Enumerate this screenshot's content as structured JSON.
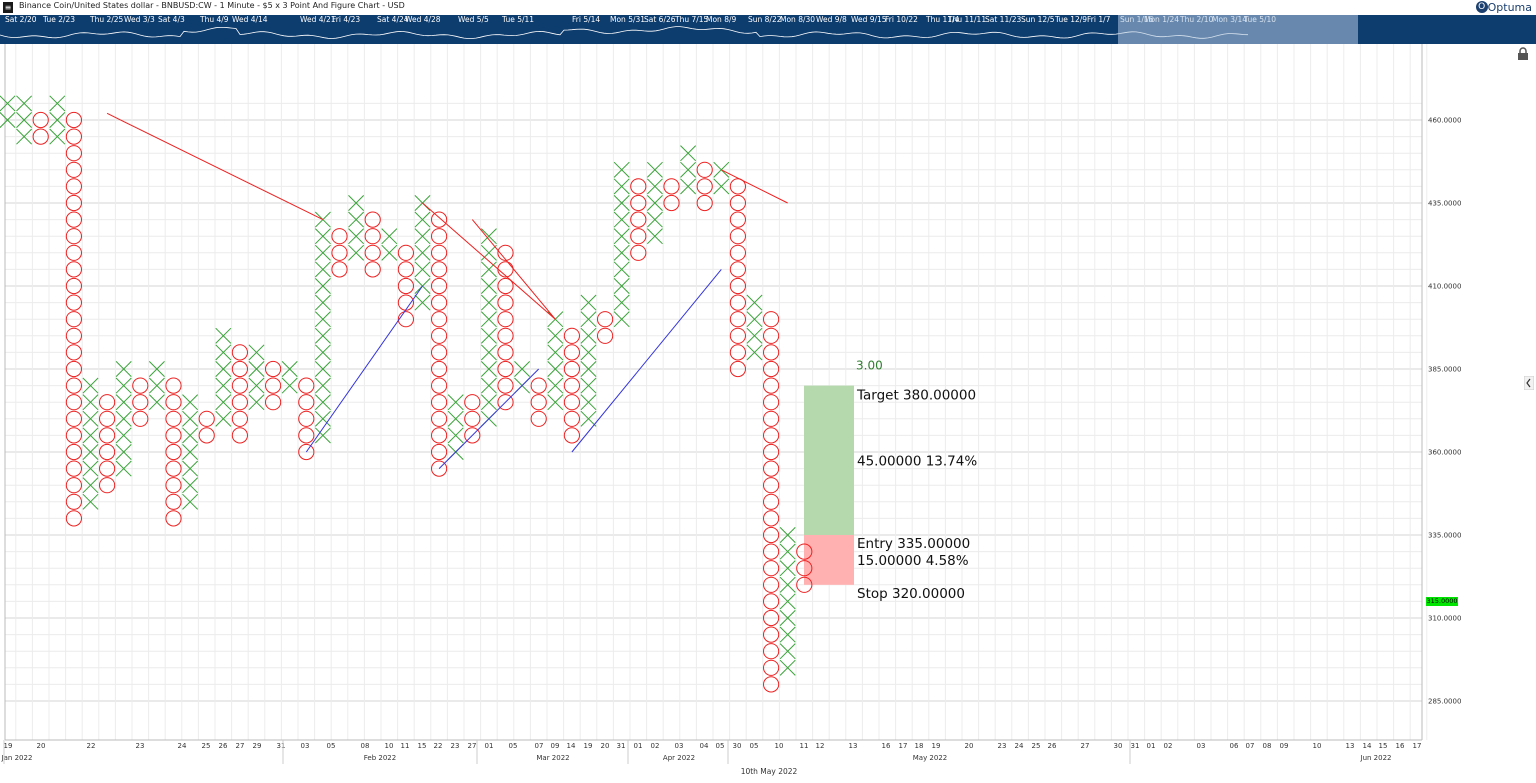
{
  "window": {
    "title": "Binance Coin/United States dollar - BNBUSD:CW - 1 Minute - $5 x 3 Point And Figure Chart - USD",
    "logo": "Optuma"
  },
  "navigator": {
    "labels": [
      "Sat 2/20",
      "Tue 2/23",
      "Thu 2/25",
      "Wed 3/3",
      "Sat 4/3",
      "Thu 4/9",
      "Wed 4/14",
      "Wed 4/21",
      "Fri 4/23",
      "Sat 4/24",
      "Wed 4/28",
      "Wed 5/5",
      "Tue 5/11",
      "Fri 5/14",
      "Mon 5/31",
      "Sat 6/26",
      "Thu 7/15",
      "Mon 8/9",
      "Sun 8/22",
      "Mon 8/30",
      "Wed 9/8",
      "Wed 9/15",
      "Fri 10/22",
      "Thu 11/4",
      "Thu 11/11",
      "Sat 11/23",
      "Sun 12/5",
      "Tue 12/9",
      "Fri 1/7",
      "Sun 1/16",
      "Mon 1/24",
      "Thu 2/10",
      "Mon 3/14",
      "Tue 5/10"
    ]
  },
  "icons": {
    "lock": "lock-icon",
    "collapse": "chevron-left-icon",
    "menu": "menu-icon"
  },
  "colors": {
    "x": "#39a339",
    "o": "#ee2020",
    "up_trend": "#3333dd",
    "down_trend": "#ee2020",
    "target_box": "#b5d9ad",
    "stop_box": "#ffb0b0",
    "navigator": "#0d3c6e",
    "last_price": "#00e600"
  },
  "chart_data": {
    "type": "point-and-figure",
    "box_size": 5,
    "reversal": 3,
    "ylim": [
      280,
      465
    ],
    "y_ticks": [
      "460.0000",
      "435.0000",
      "410.0000",
      "385.0000",
      "360.0000",
      "335.0000",
      "310.0000",
      "285.0000"
    ],
    "last_price": "315.0000",
    "columns": [
      {
        "t": "X",
        "low": 460,
        "high": 465
      },
      {
        "t": "X",
        "low": 455,
        "high": 465
      },
      {
        "t": "O",
        "low": 455,
        "high": 460
      },
      {
        "t": "X",
        "low": 455,
        "high": 465
      },
      {
        "t": "O",
        "low": 340,
        "high": 460
      },
      {
        "t": "X",
        "low": 345,
        "high": 380
      },
      {
        "t": "O",
        "low": 350,
        "high": 375
      },
      {
        "t": "X",
        "low": 355,
        "high": 385
      },
      {
        "t": "O",
        "low": 370,
        "high": 380
      },
      {
        "t": "X",
        "low": 375,
        "high": 385
      },
      {
        "t": "O",
        "low": 340,
        "high": 380
      },
      {
        "t": "X",
        "low": 345,
        "high": 375
      },
      {
        "t": "O",
        "low": 365,
        "high": 370
      },
      {
        "t": "X",
        "low": 370,
        "high": 395
      },
      {
        "t": "O",
        "low": 365,
        "high": 390
      },
      {
        "t": "X",
        "low": 375,
        "high": 390
      },
      {
        "t": "O",
        "low": 375,
        "high": 385
      },
      {
        "t": "X",
        "low": 380,
        "high": 385
      },
      {
        "t": "O",
        "low": 360,
        "high": 380
      },
      {
        "t": "X",
        "low": 365,
        "high": 430
      },
      {
        "t": "O",
        "low": 415,
        "high": 425
      },
      {
        "t": "X",
        "low": 420,
        "high": 435
      },
      {
        "t": "O",
        "low": 415,
        "high": 430
      },
      {
        "t": "X",
        "low": 420,
        "high": 425
      },
      {
        "t": "O",
        "low": 400,
        "high": 420
      },
      {
        "t": "X",
        "low": 405,
        "high": 435
      },
      {
        "t": "O",
        "low": 355,
        "high": 430
      },
      {
        "t": "X",
        "low": 360,
        "high": 375
      },
      {
        "t": "O",
        "low": 365,
        "high": 375
      },
      {
        "t": "X",
        "low": 370,
        "high": 425
      },
      {
        "t": "O",
        "low": 375,
        "high": 420
      },
      {
        "t": "X",
        "low": 380,
        "high": 385
      },
      {
        "t": "O",
        "low": 370,
        "high": 380
      },
      {
        "t": "X",
        "low": 375,
        "high": 400
      },
      {
        "t": "O",
        "low": 365,
        "high": 395
      },
      {
        "t": "X",
        "low": 370,
        "high": 405
      },
      {
        "t": "O",
        "low": 395,
        "high": 400
      },
      {
        "t": "X",
        "low": 400,
        "high": 445
      },
      {
        "t": "O",
        "low": 420,
        "high": 440
      },
      {
        "t": "X",
        "low": 425,
        "high": 445
      },
      {
        "t": "O",
        "low": 435,
        "high": 440
      },
      {
        "t": "X",
        "low": 440,
        "high": 450
      },
      {
        "t": "O",
        "low": 435,
        "high": 445
      },
      {
        "t": "X",
        "low": 440,
        "high": 445
      },
      {
        "t": "O",
        "low": 385,
        "high": 440
      },
      {
        "t": "X",
        "low": 390,
        "high": 405
      },
      {
        "t": "O",
        "low": 290,
        "high": 400
      },
      {
        "t": "X",
        "low": 295,
        "high": 335
      },
      {
        "t": "O",
        "low": 320,
        "high": 330
      }
    ],
    "trend_lines": [
      {
        "type": "down",
        "from": [
          6,
          462
        ],
        "to": [
          19,
          430
        ]
      },
      {
        "type": "up",
        "from": [
          18,
          360
        ],
        "to": [
          25,
          410
        ]
      },
      {
        "type": "down",
        "from": [
          25,
          435
        ],
        "to": [
          33,
          400
        ]
      },
      {
        "type": "up",
        "from": [
          26,
          355
        ],
        "to": [
          32,
          385
        ]
      },
      {
        "type": "down",
        "from": [
          28,
          430
        ],
        "to": [
          33,
          400
        ]
      },
      {
        "type": "up",
        "from": [
          34,
          360
        ],
        "to": [
          43,
          415
        ]
      },
      {
        "type": "down",
        "from": [
          43,
          445
        ],
        "to": [
          47,
          435
        ]
      }
    ],
    "risk_reward": {
      "ratio": "3.00",
      "target_label": "Target",
      "target": "380.00000",
      "reward": "45.00000",
      "reward_pct": "13.74%",
      "entry_label": "Entry",
      "entry": "335.00000",
      "risk": "15.00000",
      "risk_pct": "4.58%",
      "stop_label": "Stop",
      "stop": "320.00000",
      "target_value": 380,
      "entry_value": 335,
      "stop_value": 320
    },
    "x_day_labels": [
      "19",
      "20",
      "22",
      "23",
      "24",
      "25",
      "26",
      "27",
      "29",
      "31",
      "03",
      "05",
      "08",
      "10",
      "11",
      "15",
      "22",
      "23",
      "27",
      "01",
      "05",
      "07",
      "09",
      "14",
      "19",
      "20",
      "31",
      "01",
      "02",
      "03",
      "04",
      "05",
      "30",
      "05",
      "10",
      "11",
      "12",
      "13",
      "16",
      "17",
      "18",
      "19",
      "20",
      "23",
      "24",
      "25",
      "26",
      "27",
      "30",
      "31",
      "01",
      "02",
      "03",
      "06",
      "07",
      "08",
      "09",
      "10",
      "13",
      "14",
      "15",
      "16",
      "17"
    ],
    "x_month_labels": [
      "Jan 2022",
      "Feb 2022",
      "Mar 2022",
      "Apr 2022",
      "May 2022",
      "Jun 2022"
    ],
    "x_axis_caption": "10th May 2022"
  }
}
